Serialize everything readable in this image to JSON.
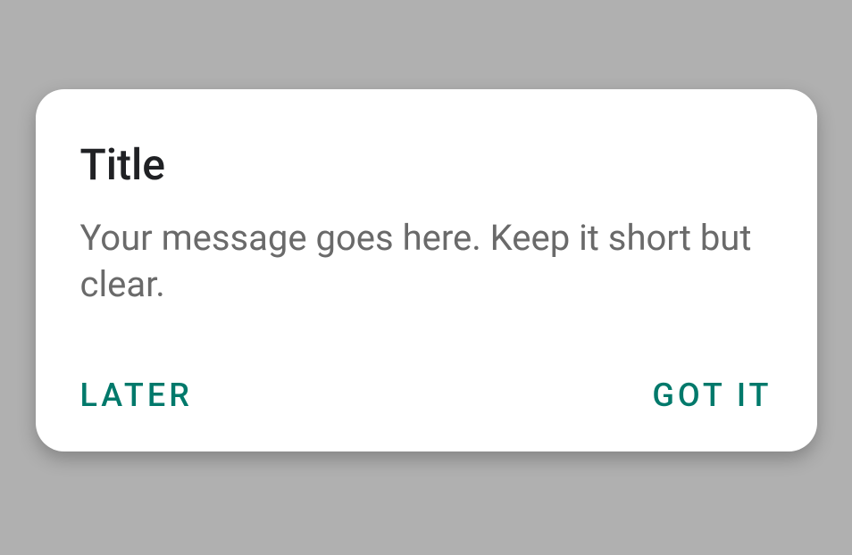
{
  "dialog": {
    "title": "Title",
    "message": "Your message goes here. Keep it short but clear.",
    "actions": {
      "negative": "LATER",
      "positive": "GOT IT"
    }
  }
}
